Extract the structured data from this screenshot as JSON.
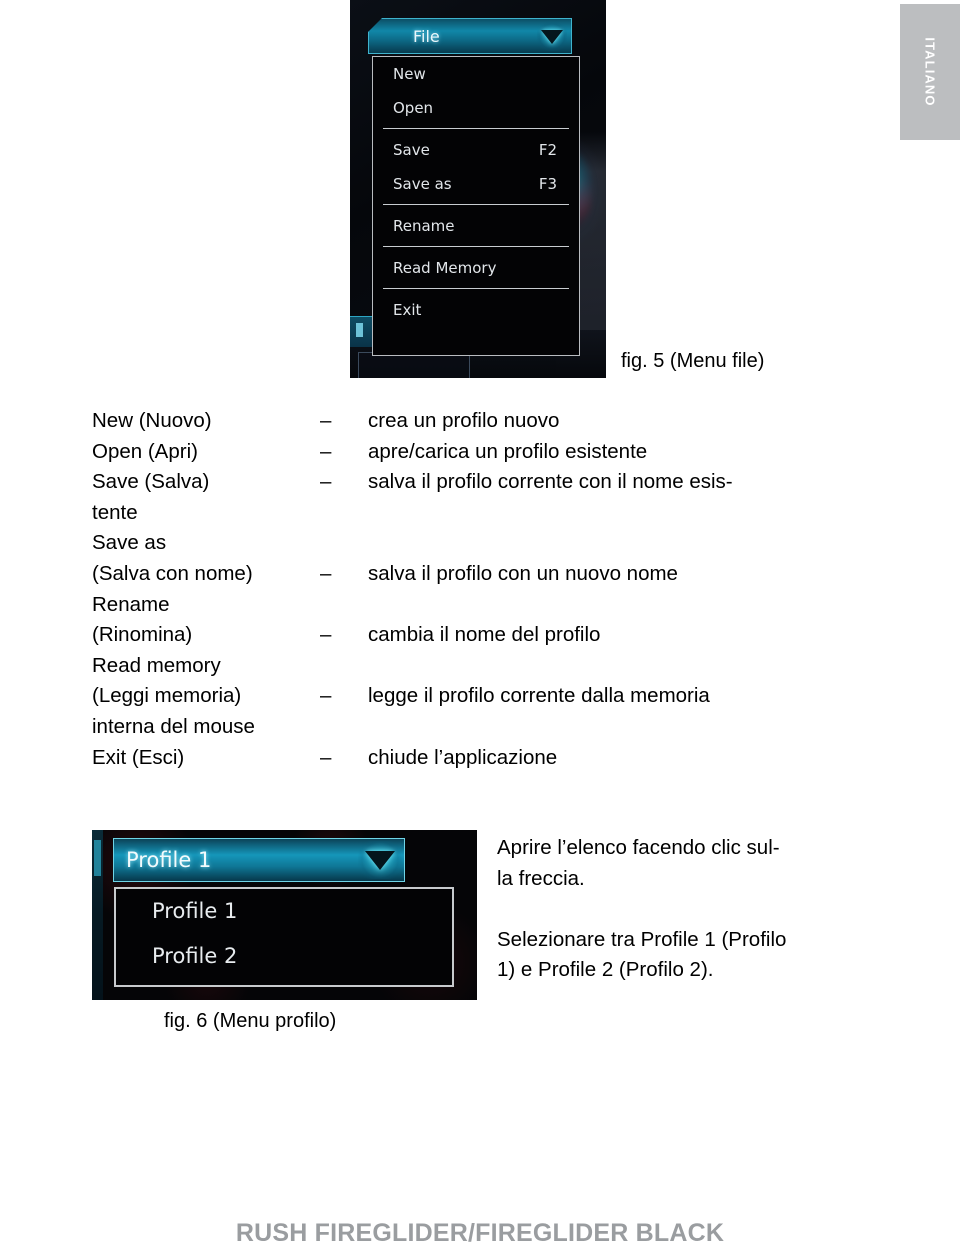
{
  "language_tab": {
    "label": "ITALIANO"
  },
  "fig5": {
    "caption": "fig. 5 (Menu file)",
    "button_label": "File",
    "caret_icon": "chevron-down-icon",
    "menu_items": [
      {
        "label": "New",
        "shortcut": ""
      },
      {
        "label": "Open",
        "shortcut": ""
      },
      {
        "label": "Save",
        "shortcut": "F2"
      },
      {
        "label": "Save as",
        "shortcut": "F3"
      },
      {
        "label": "Rename",
        "shortcut": ""
      },
      {
        "label": "Read Memory",
        "shortcut": ""
      },
      {
        "label": "Exit",
        "shortcut": ""
      }
    ]
  },
  "descriptions": {
    "dash": "–",
    "rows": [
      {
        "term": "New (Nuovo)",
        "dash": "–",
        "def": "crea un profilo nuovo"
      },
      {
        "term": "Open (Apri)",
        "dash": "–",
        "def": "apre/carica un profilo esistente"
      },
      {
        "term": "Save (Salva)",
        "dash": "–",
        "def": "salva il profilo corrente con il nome esis-"
      },
      {
        "term": "tente",
        "dash": "",
        "def": ""
      },
      {
        "term": "Save as",
        "dash": "",
        "def": ""
      },
      {
        "term": "(Salva con nome)",
        "dash": "–",
        "def": "salva il profilo con un nuovo nome"
      },
      {
        "term": "Rename",
        "dash": "",
        "def": ""
      },
      {
        "term": "(Rinomina)",
        "dash": "–",
        "def": "cambia il nome del profilo"
      },
      {
        "term": "Read memory",
        "dash": "",
        "def": ""
      },
      {
        "term": "(Leggi memoria)",
        "dash": "–",
        "def": "legge il profilo corrente dalla memoria"
      },
      {
        "term": "interna del mouse",
        "dash": "",
        "def": ""
      },
      {
        "term": "Exit (Esci)",
        "dash": "–",
        "def": "chiude l’applicazione"
      }
    ]
  },
  "fig6": {
    "caption": "fig. 6 (Menu profilo)",
    "selected_value": "Profile 1",
    "caret_icon": "chevron-down-icon",
    "options": [
      {
        "label": "Profile 1"
      },
      {
        "label": "Profile 2"
      }
    ]
  },
  "notes": {
    "lines": [
      "Aprire l’elenco facendo clic sul-",
      "la freccia.",
      "",
      "Selezionare tra Profile 1 (Profilo",
      "1) e Profile 2 (Profilo 2)."
    ]
  },
  "footer": {
    "text": "RUSH FIREGLIDER/FIREGLIDER BLACK"
  },
  "colors": {
    "accent_cyan": "#1596ba",
    "tab_grey": "#bcbec0",
    "footer_grey": "#9a9da0",
    "menu_black": "#030305",
    "menu_border": "#b9bcc0"
  }
}
